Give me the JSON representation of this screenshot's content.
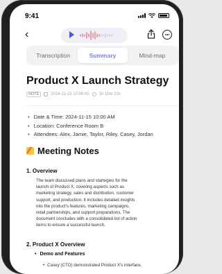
{
  "status_bar": {
    "time": "9:41"
  },
  "nav": {
    "back_icon": "chevron-left-icon",
    "share_icon": "share-icon",
    "more_icon": "more-options-icon"
  },
  "tabs": [
    {
      "label": "Transcription",
      "active": false
    },
    {
      "label": "Summary",
      "active": true
    },
    {
      "label": "Mind-map",
      "active": false
    }
  ],
  "document": {
    "title": "Product X Launch Strategy",
    "badge": "NOTE",
    "datetime": "2024-11-15 10:00:00",
    "duration": "1h 15m 23s",
    "details": [
      "Date & Time: 2024-11-15 10:00 AM",
      "Location: Conference Room B",
      "Attendees: Alex, Jamie, Taylor, Riley, Casey, Jordan"
    ],
    "section_title": "Meeting Notes",
    "overview_heading": "1. Overview",
    "overview_lines": [
      "The team discussed plans and startegies for the",
      "launch of Product X, covering aspects such as",
      "marketing strategy, sales and distribution, customer",
      "support, and production. It includes detailed insights",
      "into the product's features, marketing campaigns,",
      "retail partnerships, and support preparations. The",
      "document concludes with a consolidated list of action",
      "items to ensure a successful launch."
    ],
    "product_heading": "2. Product X Overview",
    "product_subheading": "Demo and Features",
    "product_item": "Casey (CTO) demonstrated Product X's interface,"
  },
  "colors": {
    "accent": "#7b7fe0",
    "play": "#4b57d6",
    "waveform": "#e5657a"
  }
}
